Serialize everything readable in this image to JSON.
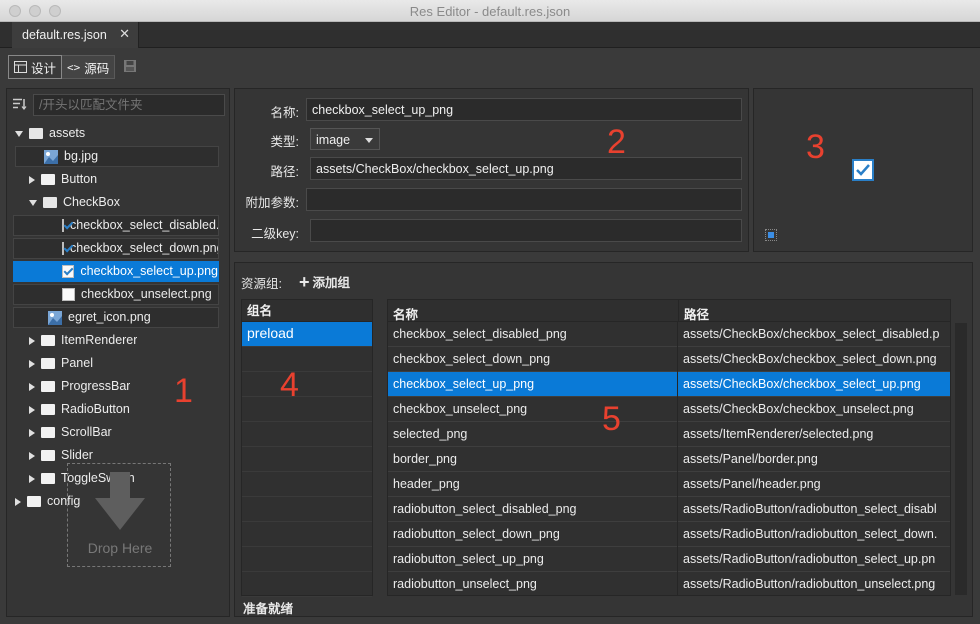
{
  "window": {
    "title": "Res Editor - default.res.json"
  },
  "tabs": [
    {
      "label": "default.res.json",
      "close": "✕"
    }
  ],
  "toolbar": {
    "design_label": "设计",
    "source_label": "源码"
  },
  "tree": {
    "filter_placeholder": "/开头以匹配文件夹",
    "items": [
      {
        "label": "assets",
        "type": "folder",
        "expanded": true
      },
      {
        "label": "bg.jpg",
        "type": "image"
      },
      {
        "label": "Button",
        "type": "folder"
      },
      {
        "label": "CheckBox",
        "type": "folder",
        "expanded": true
      },
      {
        "label": "checkbox_select_disabled.png",
        "type": "checkbox-on"
      },
      {
        "label": "checkbox_select_down.png",
        "type": "checkbox-on"
      },
      {
        "label": "checkbox_select_up.png",
        "type": "checkbox-on",
        "selected": true
      },
      {
        "label": "checkbox_unselect.png",
        "type": "checkbox-off"
      },
      {
        "label": "egret_icon.png",
        "type": "image"
      },
      {
        "label": "ItemRenderer",
        "type": "folder"
      },
      {
        "label": "Panel",
        "type": "folder"
      },
      {
        "label": "ProgressBar",
        "type": "folder"
      },
      {
        "label": "RadioButton",
        "type": "folder"
      },
      {
        "label": "ScrollBar",
        "type": "folder"
      },
      {
        "label": "Slider",
        "type": "folder"
      },
      {
        "label": "ToggleSwitch",
        "type": "folder"
      },
      {
        "label": "config",
        "type": "folder"
      }
    ],
    "drop_label": "Drop Here"
  },
  "properties": {
    "name_label": "名称:",
    "name_value": "checkbox_select_up_png",
    "type_label": "类型:",
    "type_value": "image",
    "path_label": "路径:",
    "path_value": "assets/CheckBox/checkbox_select_up.png",
    "extra_label": "附加参数:",
    "extra_value": "",
    "subkey_label": "二级key:",
    "subkey_value": ""
  },
  "groups": {
    "title": "资源组:",
    "add_label": "添加组",
    "header": "组名",
    "items": [
      {
        "label": "preload",
        "selected": true
      }
    ]
  },
  "resources": {
    "headers": {
      "name": "名称",
      "path": "路径"
    },
    "rows": [
      {
        "name": "checkbox_select_disabled_png",
        "path": "assets/CheckBox/checkbox_select_disabled.p"
      },
      {
        "name": "checkbox_select_down_png",
        "path": "assets/CheckBox/checkbox_select_down.png"
      },
      {
        "name": "checkbox_select_up_png",
        "path": "assets/CheckBox/checkbox_select_up.png",
        "selected": true
      },
      {
        "name": "checkbox_unselect_png",
        "path": "assets/CheckBox/checkbox_unselect.png"
      },
      {
        "name": "selected_png",
        "path": "assets/ItemRenderer/selected.png"
      },
      {
        "name": "border_png",
        "path": "assets/Panel/border.png"
      },
      {
        "name": "header_png",
        "path": "assets/Panel/header.png"
      },
      {
        "name": "radiobutton_select_disabled_png",
        "path": "assets/RadioButton/radiobutton_select_disabl"
      },
      {
        "name": "radiobutton_select_down_png",
        "path": "assets/RadioButton/radiobutton_select_down."
      },
      {
        "name": "radiobutton_select_up_png",
        "path": "assets/RadioButton/radiobutton_select_up.pn"
      },
      {
        "name": "radiobutton_unselect_png",
        "path": "assets/RadioButton/radiobutton_unselect.png"
      }
    ]
  },
  "status": {
    "text": "准备就绪"
  },
  "annotations": [
    "1",
    "2",
    "3",
    "4",
    "5"
  ],
  "colors": {
    "accent": "#0a7ad7",
    "annotation": "#e8412f",
    "background": "#3a3a3a"
  }
}
